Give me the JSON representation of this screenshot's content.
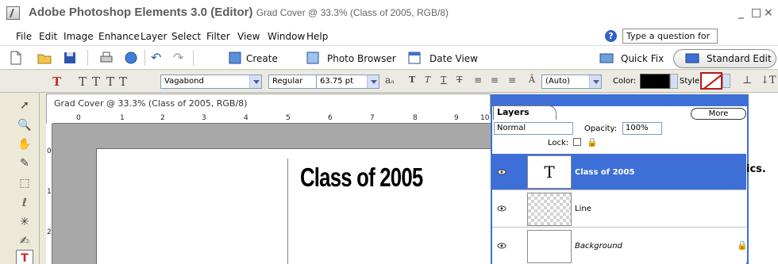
{
  "window": {
    "title_app": "Adobe Photoshop Elements 3.0 (Editor)",
    "title_doc": "Grad Cover @ 33.3% (Class of 2005, RGB/8)",
    "minimize": "_",
    "maximize": "□",
    "close": "×"
  },
  "menu": {
    "items": [
      "File",
      "Edit",
      "Image",
      "Enhance",
      "Layer",
      "Select",
      "Filter",
      "View",
      "Window",
      "Help"
    ],
    "help_placeholder": "Type a question for help"
  },
  "shortcuts": {
    "create": "Create",
    "photo_browser": "Photo Browser",
    "date_view": "Date View",
    "quick_fix": "Quick Fix",
    "standard_edit": "Standard Edit"
  },
  "options": {
    "font_family": "Vagabond",
    "font_style": "Regular",
    "font_size": "63.75 pt",
    "leading": "(Auto)",
    "color_label": "Color:",
    "style_label": "Style:",
    "text_color": "#000000"
  },
  "document": {
    "title": "Grad Cover @ 33.3% (Class of 2005, RGB/8)",
    "ruler_h": [
      "0",
      "1",
      "2",
      "3",
      "4",
      "5",
      "6",
      "7",
      "8",
      "9",
      "10"
    ],
    "ruler_v": [
      "0",
      "1",
      "2"
    ],
    "canvas_text": "Class of 2005"
  },
  "layers_palette": {
    "tab": "Layers",
    "more": "More",
    "blend_mode": "Normal",
    "opacity_label": "Opacity:",
    "opacity_value": "100%",
    "lock_label": "Lock:",
    "layers": [
      {
        "name": "Class of 2005",
        "thumb": "T",
        "selected": true
      },
      {
        "name": "Line",
        "thumb": "",
        "selected": false
      },
      {
        "name": "Background",
        "thumb": "",
        "selected": false
      }
    ]
  },
  "side": {
    "partial_text": "ics."
  },
  "colors": {
    "titlebar_blue": "#3d6fd6",
    "workspace_gray": "#a8a8a8",
    "chrome": "#ece9d8"
  }
}
